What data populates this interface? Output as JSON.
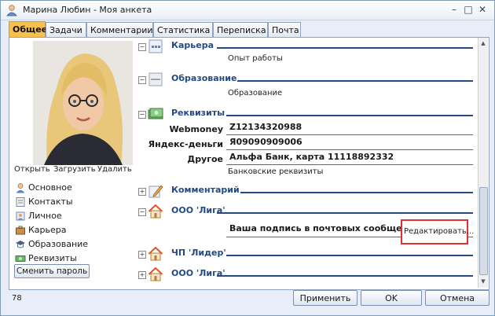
{
  "window": {
    "title": "Марина Любин - Моя анкета",
    "minimize": "–",
    "maximize": "□",
    "close": "✕"
  },
  "tabs": [
    {
      "label": "Общее",
      "active": true
    },
    {
      "label": "Задачи"
    },
    {
      "label": "Комментарии"
    },
    {
      "label": "Статистика"
    },
    {
      "label": "Переписка"
    },
    {
      "label": "Почта"
    }
  ],
  "photo_actions": {
    "open": "Открыть",
    "upload": "Загрузить",
    "delete": "Удалить"
  },
  "nav": [
    {
      "label": "Основное",
      "icon": "user-icon"
    },
    {
      "label": "Контакты",
      "icon": "contacts-icon"
    },
    {
      "label": "Личное",
      "icon": "personal-icon"
    },
    {
      "label": "Карьера",
      "icon": "career-icon"
    },
    {
      "label": "Образование",
      "icon": "education-icon"
    },
    {
      "label": "Реквизиты",
      "icon": "requisites-icon"
    }
  ],
  "change_password": "Сменить пароль",
  "sections": {
    "career": {
      "title": "Карьера",
      "sub": "Опыт работы"
    },
    "education": {
      "title": "Образование",
      "sub": "Образование"
    },
    "requisites": {
      "title": "Реквизиты",
      "rows": [
        {
          "label": "Webmoney",
          "value": "Z12134320988"
        },
        {
          "label": "Яндекс-деньги",
          "value": "Я09090909006"
        },
        {
          "label": "Другое",
          "value": "Альфа Банк, карта 11118892332"
        }
      ],
      "sub": "Банковские реквизиты"
    },
    "comment": {
      "title": "Комментарий"
    },
    "liga1": {
      "title": "ООО 'Лига'",
      "signature": "Ваша подпись в почтовых сообщениях",
      "edit": "Редактировать..."
    },
    "leader": {
      "title": "ЧП 'Лидер'"
    },
    "liga2": {
      "title": "ООО 'Лига'"
    }
  },
  "status_count": "78",
  "buttons": {
    "apply": "Применить",
    "ok": "OK",
    "cancel": "Отмена"
  },
  "colors": {
    "accent_tab": "#f6c04d",
    "section_title": "#244a86",
    "highlight_box": "#e03030"
  }
}
